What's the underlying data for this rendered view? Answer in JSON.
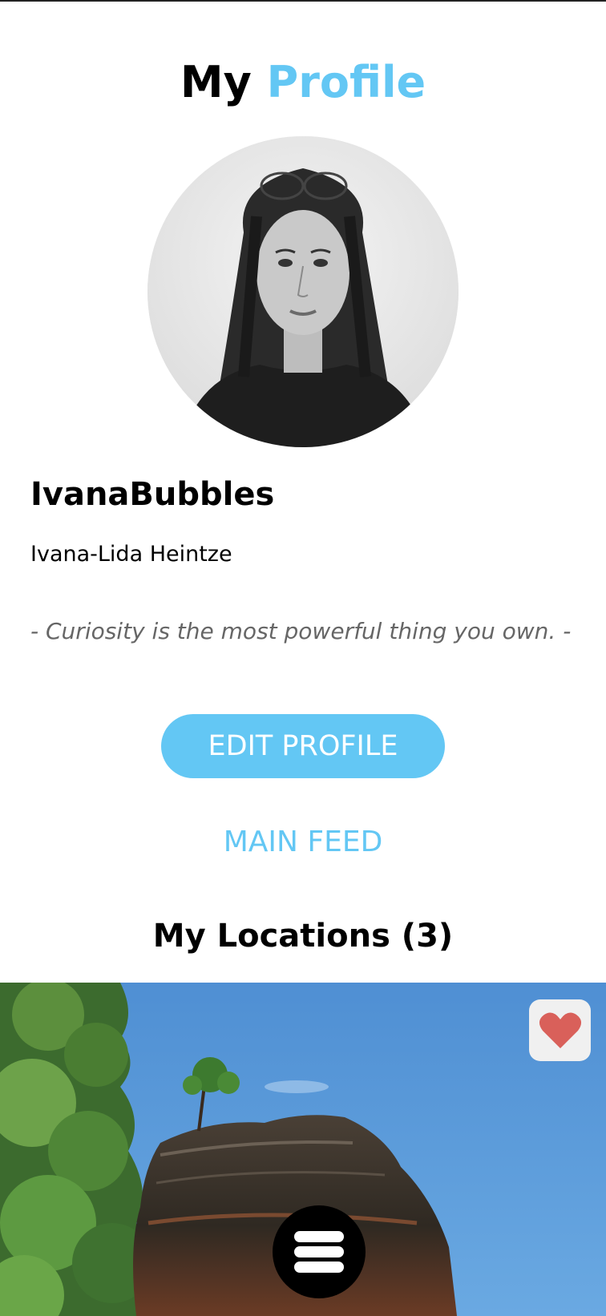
{
  "header": {
    "title_part1": "My",
    "title_part2": "Profile",
    "accent_color": "#63c7f4"
  },
  "profile": {
    "avatar_icon": "profile-photo",
    "username": "IvanaBubbles",
    "full_name": "Ivana-Lida Heintze",
    "quote": "- Curiosity is the most powerful thing you own. -"
  },
  "actions": {
    "edit_profile_label": "EDIT PROFILE",
    "main_feed_label": "MAIN FEED"
  },
  "locations": {
    "heading": "My Locations (3)",
    "card_image": "rock-formation-photo",
    "favorite_icon": "heart-icon",
    "favorite_color": "#d9605a"
  },
  "nav": {
    "menu_icon": "hamburger-menu-icon"
  }
}
